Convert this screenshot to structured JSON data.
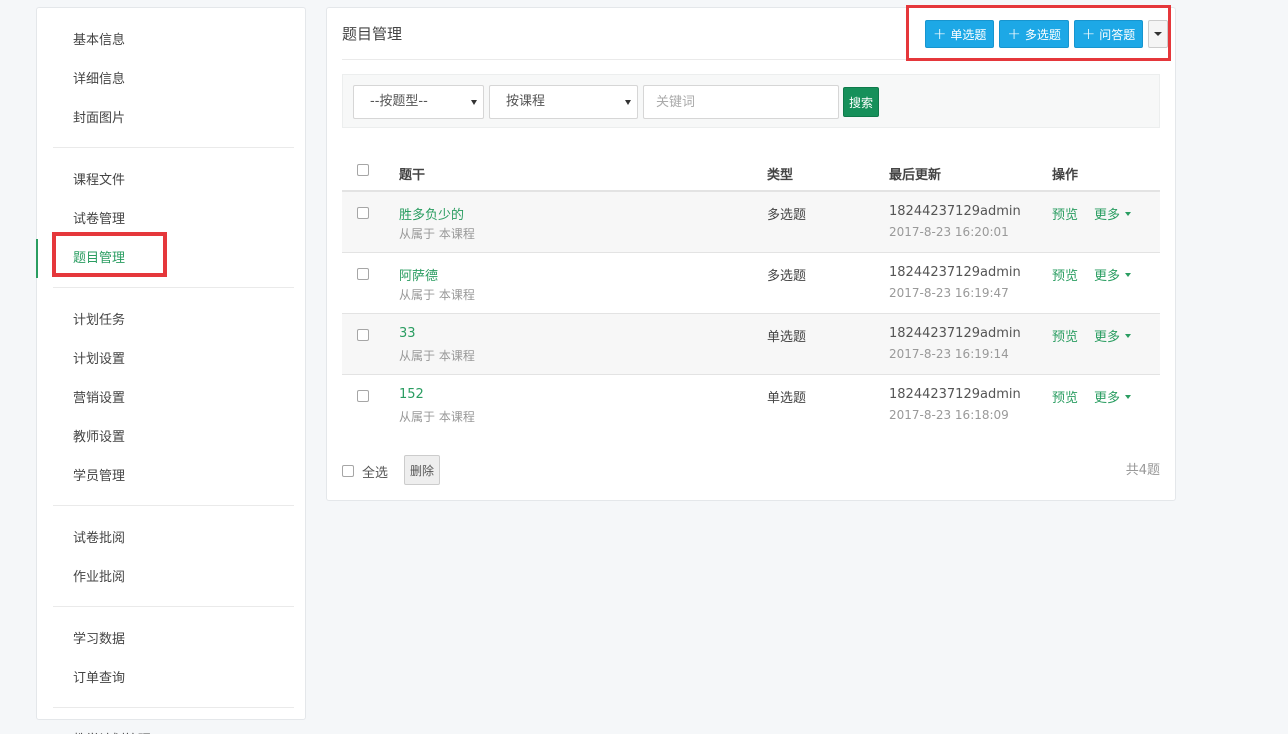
{
  "sidebar": {
    "groups": [
      [
        "基本信息",
        "详细信息",
        "封面图片"
      ],
      [
        "课程文件",
        "试卷管理",
        "题目管理"
      ],
      [
        "计划任务",
        "计划设置",
        "营销设置",
        "教师设置",
        "学员管理"
      ],
      [
        "试卷批阅",
        "作业批阅"
      ],
      [
        "学习数据",
        "订单查询"
      ],
      [
        "教学计划管理"
      ]
    ],
    "active": "题目管理"
  },
  "panel": {
    "title": "题目管理",
    "buttons": {
      "single": "单选题",
      "multi": "多选题",
      "essay": "问答题"
    }
  },
  "filters": {
    "type_select": "--按题型--",
    "course_select": "按课程",
    "keyword_placeholder": "关键词",
    "search_label": "搜索"
  },
  "table": {
    "headers": {
      "title": "题干",
      "type": "类型",
      "updated": "最后更新",
      "ops": "操作"
    },
    "rows": [
      {
        "title": "胜多负少的",
        "sub": "从属于 本课程",
        "type": "多选题",
        "user": "18244237129admin",
        "time": "2017-8-23 16:20:01",
        "preview": "预览",
        "more": "更多"
      },
      {
        "title": "阿萨德",
        "sub": "从属于 本课程",
        "type": "多选题",
        "user": "18244237129admin",
        "time": "2017-8-23 16:19:47",
        "preview": "预览",
        "more": "更多"
      },
      {
        "title": "33",
        "sub": "从属于 本课程",
        "type": "单选题",
        "user": "18244237129admin",
        "time": "2017-8-23 16:19:14",
        "preview": "预览",
        "more": "更多"
      },
      {
        "title": "152",
        "sub": "从属于 本课程",
        "type": "单选题",
        "user": "18244237129admin",
        "time": "2017-8-23 16:18:09",
        "preview": "预览",
        "more": "更多"
      }
    ]
  },
  "footer": {
    "select_all": "全选",
    "delete_label": "删除",
    "total": "共4题"
  },
  "colors": {
    "accent_green": "#2a9d61",
    "primary_blue": "#1da8e6",
    "highlight_red": "#e5373b"
  }
}
